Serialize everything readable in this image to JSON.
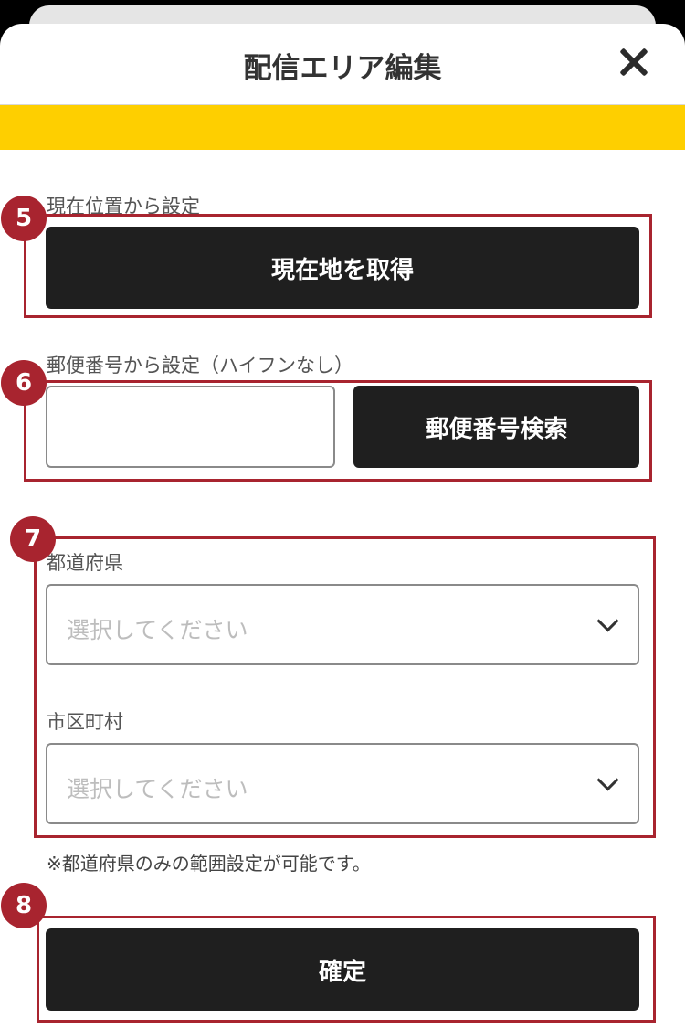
{
  "header": {
    "title": "配信エリア編集",
    "close_icon": "close-icon"
  },
  "sections": {
    "current_location": {
      "badge": "5",
      "label": "現在位置から設定",
      "button_label": "現在地を取得"
    },
    "postal_code": {
      "badge": "6",
      "label": "郵便番号から設定（ハイフンなし）",
      "input_value": "",
      "input_placeholder": "",
      "button_label": "郵便番号検索"
    },
    "area_select": {
      "badge": "7",
      "prefecture_label": "都道府県",
      "prefecture_placeholder": "選択してください",
      "city_label": "市区町村",
      "city_placeholder": "選択してください",
      "chevron_icon": "chevron-down-icon",
      "note": "※都道府県のみの範囲設定が可能です。"
    },
    "confirm": {
      "badge": "8",
      "button_label": "確定"
    }
  },
  "colors": {
    "accent_banner": "#fecf00",
    "button_dark": "#1f1f1f",
    "annotation_red": "#a8242f"
  }
}
